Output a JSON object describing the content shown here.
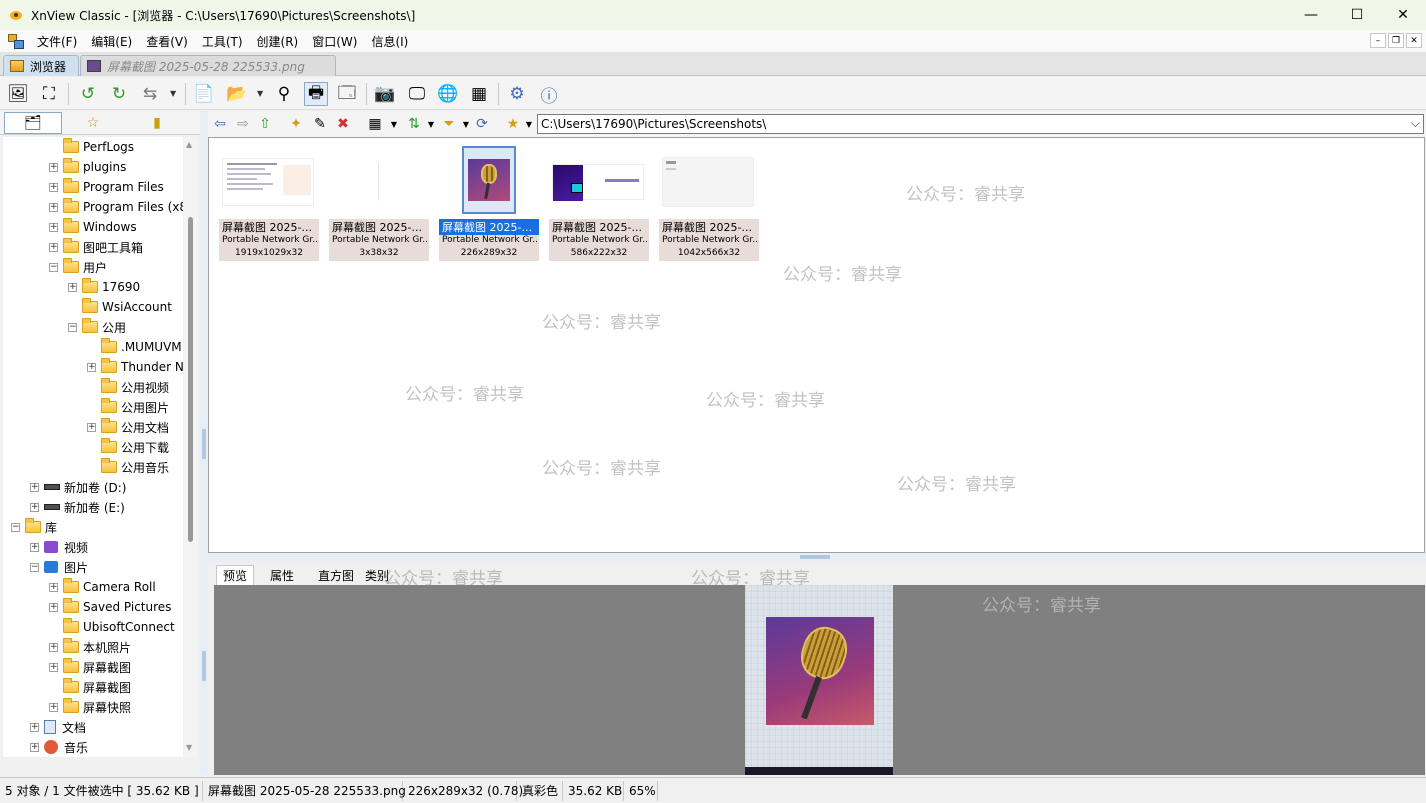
{
  "window": {
    "title": "XnView Classic - [浏览器 - C:\\Users\\17690\\Pictures\\Screenshots\\]",
    "minimize": "—",
    "maximize": "☐",
    "close": "✕"
  },
  "menu": [
    "文件(F)",
    "编辑(E)",
    "查看(V)",
    "工具(T)",
    "创建(R)",
    "窗口(W)",
    "信息(I)"
  ],
  "tabs": {
    "browser": "浏览器",
    "image": "屏幕截图 2025-05-28 225533.png"
  },
  "address": {
    "path": "C:\\Users\\17690\\Pictures\\Screenshots\\"
  },
  "tree": [
    {
      "label": "PerfLogs"
    },
    {
      "label": "plugins"
    },
    {
      "label": "Program Files"
    },
    {
      "label": "Program Files (x8"
    },
    {
      "label": "Windows"
    },
    {
      "label": "图吧工具箱"
    },
    {
      "label": "用户"
    },
    {
      "label": "17690"
    },
    {
      "label": "WsiAccount"
    },
    {
      "label": "公用"
    },
    {
      "label": ".MUMUVM"
    },
    {
      "label": "Thunder N"
    },
    {
      "label": "公用视频"
    },
    {
      "label": "公用图片"
    },
    {
      "label": "公用文档"
    },
    {
      "label": "公用下载"
    },
    {
      "label": "公用音乐"
    },
    {
      "label": "新加卷 (D:)"
    },
    {
      "label": "新加卷 (E:)"
    },
    {
      "label": "库"
    },
    {
      "label": "视频"
    },
    {
      "label": "图片"
    },
    {
      "label": "Camera Roll"
    },
    {
      "label": "Saved Pictures"
    },
    {
      "label": "UbisoftConnect"
    },
    {
      "label": "本机照片"
    },
    {
      "label": "屏幕截图"
    },
    {
      "label": "屏幕截图"
    },
    {
      "label": "屏幕快照"
    },
    {
      "label": "文档"
    },
    {
      "label": "音乐"
    }
  ],
  "thumbnails": [
    {
      "name": "屏幕截图 2025-...",
      "format": "Portable Network Gr...",
      "dims": "1919x1029x32"
    },
    {
      "name": "屏幕截图 2025-...",
      "format": "Portable Network Gr...",
      "dims": "3x38x32"
    },
    {
      "name": "屏幕截图 2025-...",
      "format": "Portable Network Gr...",
      "dims": "226x289x32"
    },
    {
      "name": "屏幕截图 2025-...",
      "format": "Portable Network Gr...",
      "dims": "586x222x32"
    },
    {
      "name": "屏幕截图 2025-...",
      "format": "Portable Network Gr...",
      "dims": "1042x566x32"
    }
  ],
  "preview_tabs": [
    "预览",
    "属性",
    "直方图",
    "类别"
  ],
  "watermark": "公众号：睿共享",
  "status": {
    "objects": "5 对象 / 1 文件被选中  [ 35.62 KB ]",
    "filename": "屏幕截图 2025-05-28 225533.png",
    "dims": "226x289x32 (0.78)",
    "color": "真彩色",
    "size": "35.62 KB",
    "zoom": "65%"
  },
  "colors": {
    "selection": "#1a6ee0",
    "folder": "#f6c343",
    "preview_bg": "#808080"
  }
}
